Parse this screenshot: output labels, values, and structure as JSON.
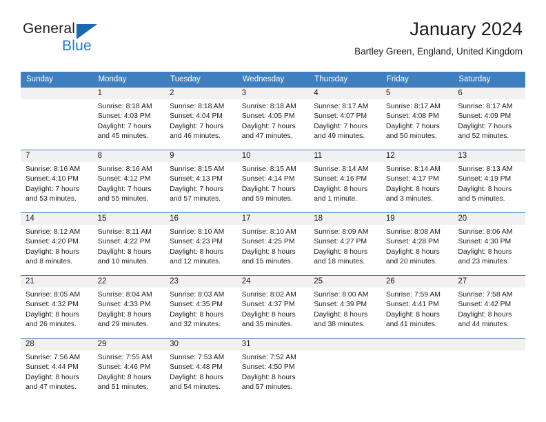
{
  "brand": {
    "name_part1": "General",
    "name_part2": "Blue",
    "triangle_color": "#1b69b2",
    "blue_color": "#1b7ad1"
  },
  "header": {
    "title": "January 2024",
    "subtitle": "Bartley Green, England, United Kingdom"
  },
  "theme": {
    "header_blue": "#3f7fbf",
    "daynum_band": "#f1f1f1"
  },
  "weekdays": [
    "Sunday",
    "Monday",
    "Tuesday",
    "Wednesday",
    "Thursday",
    "Friday",
    "Saturday"
  ],
  "weeks": [
    [
      {
        "day": "",
        "empty": true
      },
      {
        "day": "1",
        "sunrise": "Sunrise: 8:18 AM",
        "sunset": "Sunset: 4:03 PM",
        "daylight1": "Daylight: 7 hours",
        "daylight2": "and 45 minutes."
      },
      {
        "day": "2",
        "sunrise": "Sunrise: 8:18 AM",
        "sunset": "Sunset: 4:04 PM",
        "daylight1": "Daylight: 7 hours",
        "daylight2": "and 46 minutes."
      },
      {
        "day": "3",
        "sunrise": "Sunrise: 8:18 AM",
        "sunset": "Sunset: 4:05 PM",
        "daylight1": "Daylight: 7 hours",
        "daylight2": "and 47 minutes."
      },
      {
        "day": "4",
        "sunrise": "Sunrise: 8:17 AM",
        "sunset": "Sunset: 4:07 PM",
        "daylight1": "Daylight: 7 hours",
        "daylight2": "and 49 minutes."
      },
      {
        "day": "5",
        "sunrise": "Sunrise: 8:17 AM",
        "sunset": "Sunset: 4:08 PM",
        "daylight1": "Daylight: 7 hours",
        "daylight2": "and 50 minutes."
      },
      {
        "day": "6",
        "sunrise": "Sunrise: 8:17 AM",
        "sunset": "Sunset: 4:09 PM",
        "daylight1": "Daylight: 7 hours",
        "daylight2": "and 52 minutes."
      }
    ],
    [
      {
        "day": "7",
        "sunrise": "Sunrise: 8:16 AM",
        "sunset": "Sunset: 4:10 PM",
        "daylight1": "Daylight: 7 hours",
        "daylight2": "and 53 minutes."
      },
      {
        "day": "8",
        "sunrise": "Sunrise: 8:16 AM",
        "sunset": "Sunset: 4:12 PM",
        "daylight1": "Daylight: 7 hours",
        "daylight2": "and 55 minutes."
      },
      {
        "day": "9",
        "sunrise": "Sunrise: 8:15 AM",
        "sunset": "Sunset: 4:13 PM",
        "daylight1": "Daylight: 7 hours",
        "daylight2": "and 57 minutes."
      },
      {
        "day": "10",
        "sunrise": "Sunrise: 8:15 AM",
        "sunset": "Sunset: 4:14 PM",
        "daylight1": "Daylight: 7 hours",
        "daylight2": "and 59 minutes."
      },
      {
        "day": "11",
        "sunrise": "Sunrise: 8:14 AM",
        "sunset": "Sunset: 4:16 PM",
        "daylight1": "Daylight: 8 hours",
        "daylight2": "and 1 minute."
      },
      {
        "day": "12",
        "sunrise": "Sunrise: 8:14 AM",
        "sunset": "Sunset: 4:17 PM",
        "daylight1": "Daylight: 8 hours",
        "daylight2": "and 3 minutes."
      },
      {
        "day": "13",
        "sunrise": "Sunrise: 8:13 AM",
        "sunset": "Sunset: 4:19 PM",
        "daylight1": "Daylight: 8 hours",
        "daylight2": "and 5 minutes."
      }
    ],
    [
      {
        "day": "14",
        "sunrise": "Sunrise: 8:12 AM",
        "sunset": "Sunset: 4:20 PM",
        "daylight1": "Daylight: 8 hours",
        "daylight2": "and 8 minutes."
      },
      {
        "day": "15",
        "sunrise": "Sunrise: 8:11 AM",
        "sunset": "Sunset: 4:22 PM",
        "daylight1": "Daylight: 8 hours",
        "daylight2": "and 10 minutes."
      },
      {
        "day": "16",
        "sunrise": "Sunrise: 8:10 AM",
        "sunset": "Sunset: 4:23 PM",
        "daylight1": "Daylight: 8 hours",
        "daylight2": "and 12 minutes."
      },
      {
        "day": "17",
        "sunrise": "Sunrise: 8:10 AM",
        "sunset": "Sunset: 4:25 PM",
        "daylight1": "Daylight: 8 hours",
        "daylight2": "and 15 minutes."
      },
      {
        "day": "18",
        "sunrise": "Sunrise: 8:09 AM",
        "sunset": "Sunset: 4:27 PM",
        "daylight1": "Daylight: 8 hours",
        "daylight2": "and 18 minutes."
      },
      {
        "day": "19",
        "sunrise": "Sunrise: 8:08 AM",
        "sunset": "Sunset: 4:28 PM",
        "daylight1": "Daylight: 8 hours",
        "daylight2": "and 20 minutes."
      },
      {
        "day": "20",
        "sunrise": "Sunrise: 8:06 AM",
        "sunset": "Sunset: 4:30 PM",
        "daylight1": "Daylight: 8 hours",
        "daylight2": "and 23 minutes."
      }
    ],
    [
      {
        "day": "21",
        "sunrise": "Sunrise: 8:05 AM",
        "sunset": "Sunset: 4:32 PM",
        "daylight1": "Daylight: 8 hours",
        "daylight2": "and 26 minutes."
      },
      {
        "day": "22",
        "sunrise": "Sunrise: 8:04 AM",
        "sunset": "Sunset: 4:33 PM",
        "daylight1": "Daylight: 8 hours",
        "daylight2": "and 29 minutes."
      },
      {
        "day": "23",
        "sunrise": "Sunrise: 8:03 AM",
        "sunset": "Sunset: 4:35 PM",
        "daylight1": "Daylight: 8 hours",
        "daylight2": "and 32 minutes."
      },
      {
        "day": "24",
        "sunrise": "Sunrise: 8:02 AM",
        "sunset": "Sunset: 4:37 PM",
        "daylight1": "Daylight: 8 hours",
        "daylight2": "and 35 minutes."
      },
      {
        "day": "25",
        "sunrise": "Sunrise: 8:00 AM",
        "sunset": "Sunset: 4:39 PM",
        "daylight1": "Daylight: 8 hours",
        "daylight2": "and 38 minutes."
      },
      {
        "day": "26",
        "sunrise": "Sunrise: 7:59 AM",
        "sunset": "Sunset: 4:41 PM",
        "daylight1": "Daylight: 8 hours",
        "daylight2": "and 41 minutes."
      },
      {
        "day": "27",
        "sunrise": "Sunrise: 7:58 AM",
        "sunset": "Sunset: 4:42 PM",
        "daylight1": "Daylight: 8 hours",
        "daylight2": "and 44 minutes."
      }
    ],
    [
      {
        "day": "28",
        "sunrise": "Sunrise: 7:56 AM",
        "sunset": "Sunset: 4:44 PM",
        "daylight1": "Daylight: 8 hours",
        "daylight2": "and 47 minutes."
      },
      {
        "day": "29",
        "sunrise": "Sunrise: 7:55 AM",
        "sunset": "Sunset: 4:46 PM",
        "daylight1": "Daylight: 8 hours",
        "daylight2": "and 51 minutes."
      },
      {
        "day": "30",
        "sunrise": "Sunrise: 7:53 AM",
        "sunset": "Sunset: 4:48 PM",
        "daylight1": "Daylight: 8 hours",
        "daylight2": "and 54 minutes."
      },
      {
        "day": "31",
        "sunrise": "Sunrise: 7:52 AM",
        "sunset": "Sunset: 4:50 PM",
        "daylight1": "Daylight: 8 hours",
        "daylight2": "and 57 minutes."
      },
      {
        "day": "",
        "empty": true
      },
      {
        "day": "",
        "empty": true
      },
      {
        "day": "",
        "empty": true
      }
    ]
  ]
}
